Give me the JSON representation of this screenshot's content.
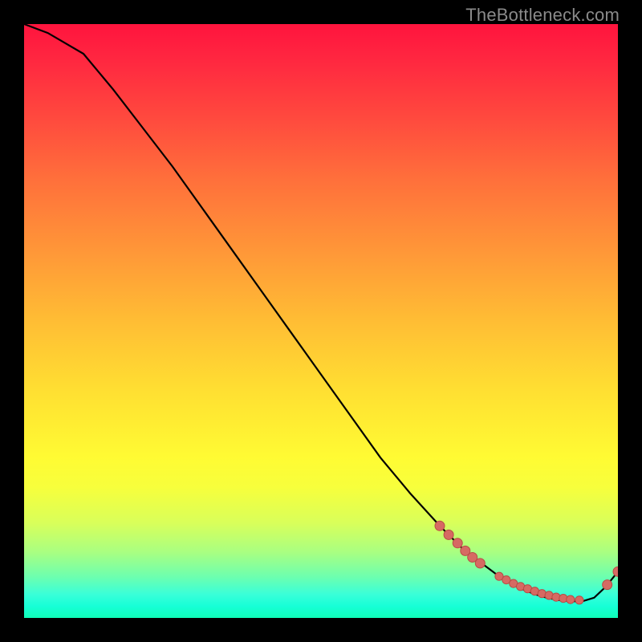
{
  "watermark": "TheBottleneck.com",
  "colors": {
    "background": "#000000",
    "curve": "#000000",
    "marker_fill": "#d66a63",
    "marker_stroke": "#b94c45",
    "gradient_top": "#ff143e",
    "gradient_bottom": "#0fffb8"
  },
  "chart_data": {
    "type": "line",
    "title": "",
    "xlabel": "",
    "ylabel": "",
    "xlim": [
      0,
      100
    ],
    "ylim": [
      0,
      100
    ],
    "notes": "Axes unlabeled; values are relative plot percentages (0–100 both axes). Curve starts at top-left, falls roughly linearly to bottom-right quarter, flattens, then ticks up at far right.",
    "series": [
      {
        "name": "bottleneck-curve",
        "x": [
          0,
          4,
          10,
          15,
          20,
          25,
          30,
          35,
          40,
          45,
          50,
          55,
          60,
          65,
          70,
          74,
          76,
          78,
          80,
          82,
          84,
          86,
          88,
          90,
          92,
          94,
          96,
          98,
          100
        ],
        "y": [
          100,
          98.5,
          95,
          89,
          82.5,
          76,
          69,
          62,
          55,
          48,
          41,
          34,
          27,
          21,
          15.5,
          11.5,
          10,
          8.5,
          7,
          5.8,
          4.8,
          4,
          3.4,
          3,
          2.8,
          2.8,
          3.4,
          5.3,
          7.8
        ]
      }
    ],
    "markers": {
      "name": "highlighted-points",
      "segment_a_x": [
        70,
        71.5,
        73,
        74.3,
        75.5,
        76.8
      ],
      "segment_a_y": [
        15.5,
        14,
        12.6,
        11.3,
        10.2,
        9.2
      ],
      "segment_b_x": [
        80,
        81.2,
        82.4,
        83.6,
        84.8,
        86,
        87.2,
        88.4,
        89.6,
        90.8,
        92,
        93.5
      ],
      "segment_b_y": [
        7,
        6.4,
        5.8,
        5.3,
        4.9,
        4.5,
        4.1,
        3.8,
        3.5,
        3.3,
        3.1,
        3
      ],
      "tail_x": [
        98.2,
        100
      ],
      "tail_y": [
        5.6,
        7.8
      ],
      "radius": 6.0
    }
  }
}
